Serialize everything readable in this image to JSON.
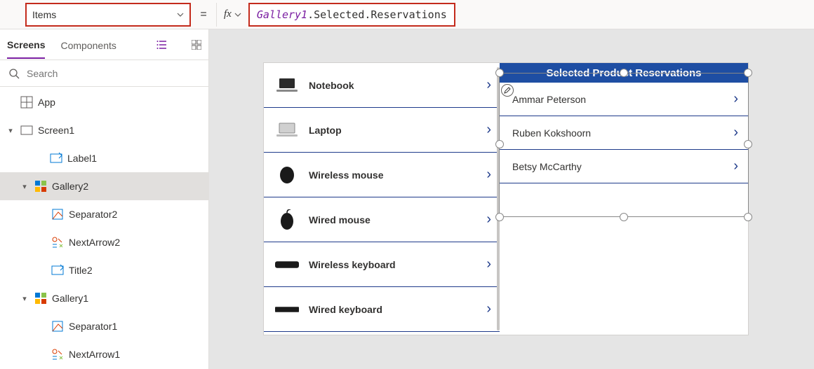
{
  "formula": {
    "property": "Items",
    "identifier": "Gallery1",
    "rest": ".Selected.Reservations"
  },
  "treeTabs": {
    "screens": "Screens",
    "components": "Components"
  },
  "search": {
    "placeholder": "Search"
  },
  "tree": {
    "app": "App",
    "screen1": "Screen1",
    "label1": "Label1",
    "gallery2": "Gallery2",
    "separator2": "Separator2",
    "nextarrow2": "NextArrow2",
    "title2": "Title2",
    "gallery1": "Gallery1",
    "separator1": "Separator1",
    "nextarrow1": "NextArrow1"
  },
  "header": {
    "title": "Selected Product Reservations"
  },
  "gallery1": {
    "items": [
      {
        "title": "Notebook"
      },
      {
        "title": "Laptop"
      },
      {
        "title": "Wireless mouse"
      },
      {
        "title": "Wired mouse"
      },
      {
        "title": "Wireless keyboard"
      },
      {
        "title": "Wired keyboard"
      }
    ]
  },
  "gallery2": {
    "items": [
      {
        "title": "Ammar Peterson"
      },
      {
        "title": "Ruben Kokshoorn"
      },
      {
        "title": "Betsy McCarthy"
      }
    ]
  }
}
